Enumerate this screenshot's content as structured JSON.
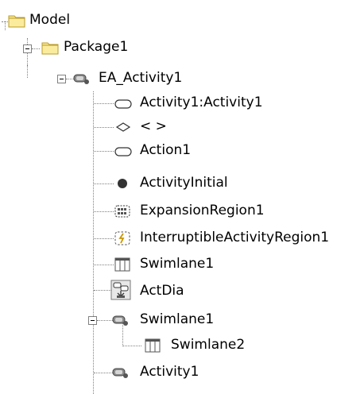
{
  "tree": {
    "model": {
      "label": "Model",
      "icon": "folder-icon"
    },
    "package1": {
      "label": "Package1",
      "icon": "folder-icon",
      "expanded": true
    },
    "ea_activity1": {
      "label": "EA_Activity1",
      "icon": "activity-icon",
      "expanded": true
    },
    "activity1_activity1": {
      "label": "Activity1:Activity1",
      "icon": "action-icon"
    },
    "decision": {
      "label": "< >",
      "icon": "decision-icon"
    },
    "action1": {
      "label": "Action1",
      "icon": "action-icon"
    },
    "activity_initial": {
      "label": "ActivityInitial",
      "icon": "initial-node-icon"
    },
    "expansion_region1": {
      "label": "ExpansionRegion1",
      "icon": "expansion-region-icon"
    },
    "interruptible_region1": {
      "label": "InterruptibleActivityRegion1",
      "icon": "interruptible-region-icon"
    },
    "swimlane1_partition": {
      "label": "Swimlane1",
      "icon": "swimlane-icon"
    },
    "actdia": {
      "label": "ActDia",
      "icon": "diagram-icon"
    },
    "swimlane1_activity": {
      "label": "Swimlane1",
      "icon": "activity-icon",
      "expanded": true
    },
    "swimlane2": {
      "label": "Swimlane2",
      "icon": "swimlane-icon"
    },
    "activity1": {
      "label": "Activity1",
      "icon": "activity-icon"
    }
  },
  "colors": {
    "folder": "#f6e58d",
    "folder_border": "#b99b2c",
    "line": "#808080",
    "icon_grey": "#5a5a5a"
  }
}
